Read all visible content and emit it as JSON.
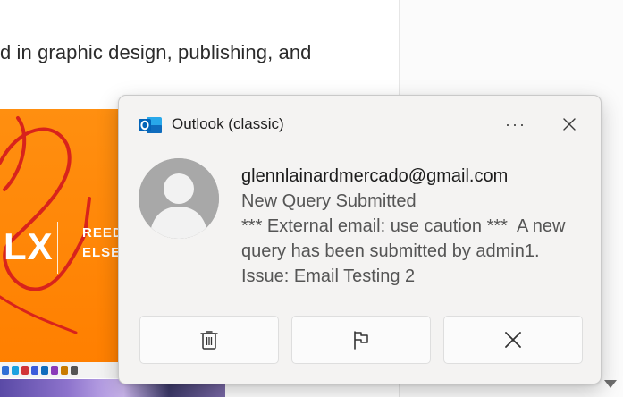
{
  "background_document": {
    "text_fragment": "d in graphic design, publishing, and",
    "banner": {
      "brand_partial": "LX",
      "line1": "REED",
      "line2": "ELSE",
      "color": "#ff8000"
    }
  },
  "notification": {
    "app_name": "Outlook (classic)",
    "app_icon": "outlook-icon",
    "more_label": "···",
    "close_icon": "close-icon",
    "sender": "glennlainardmercado@gmail.com",
    "subject": "New Query Submitted",
    "body": "*** External email: use caution ***  A new query has been submitted by admin1. Issue: Email Testing 2",
    "avatar_icon": "person-icon",
    "actions": [
      {
        "name": "delete",
        "icon": "trash-icon"
      },
      {
        "name": "flag",
        "icon": "flag-icon"
      },
      {
        "name": "dismiss",
        "icon": "close-icon"
      }
    ],
    "colors": {
      "background": "#f4f3f2",
      "accent_blue": "#0f6cbd",
      "avatar_gray": "#a8a8a8"
    }
  }
}
